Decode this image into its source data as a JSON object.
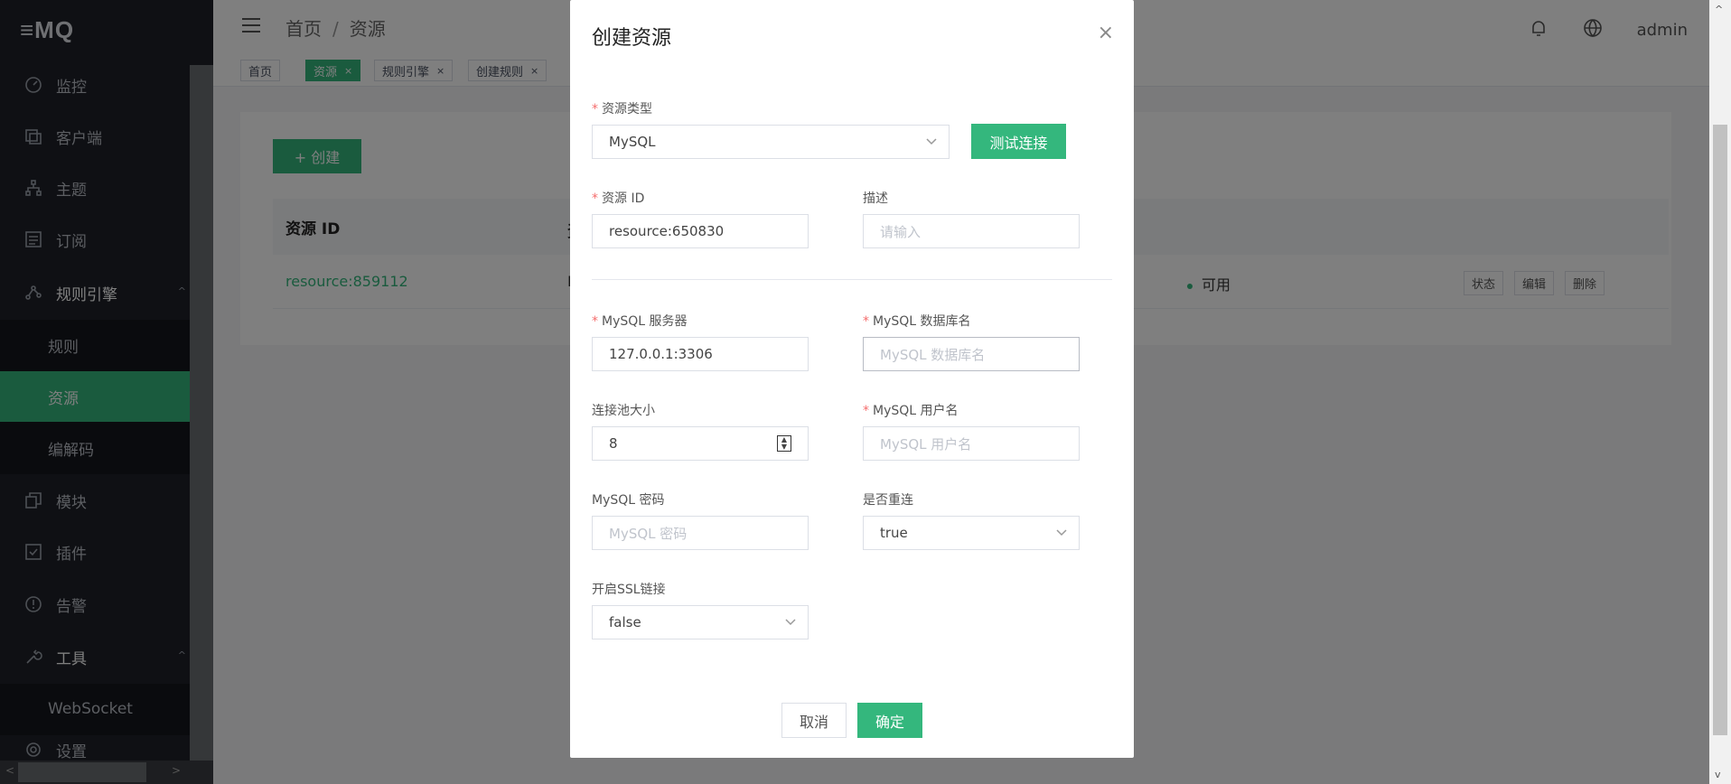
{
  "app": {
    "logo": "≡MQ"
  },
  "sidebar": {
    "items": [
      {
        "label": "监控"
      },
      {
        "label": "客户端"
      },
      {
        "label": "主题"
      },
      {
        "label": "订阅"
      },
      {
        "label": "规则引擎"
      },
      {
        "label": "模块"
      },
      {
        "label": "插件"
      },
      {
        "label": "告警"
      },
      {
        "label": "工具"
      },
      {
        "label": "设置"
      }
    ],
    "rule_sub": [
      {
        "label": "规则"
      },
      {
        "label": "资源"
      },
      {
        "label": "编解码"
      }
    ],
    "tools_sub": [
      {
        "label": "WebSocket"
      }
    ]
  },
  "header": {
    "breadcrumb": [
      "首页",
      "资源"
    ],
    "separator": "/",
    "user": "admin"
  },
  "tags": [
    {
      "label": "首页"
    },
    {
      "label": "资源",
      "close": "×"
    },
    {
      "label": "规则引擎",
      "close": "×"
    },
    {
      "label": "创建规则",
      "close": "×"
    }
  ],
  "main": {
    "create_label": "+  创建",
    "table": {
      "headers": [
        "资源 ID",
        "资"
      ],
      "rows": [
        {
          "id": "resource:859112",
          "partial": "M",
          "status": "可用",
          "actions": [
            "状态",
            "编辑",
            "删除"
          ]
        }
      ]
    }
  },
  "dialog": {
    "title": "创建资源",
    "close": "×",
    "type_label": "资源类型",
    "type_value": "MySQL",
    "test_label": "测试连接",
    "id_label": "资源 ID",
    "id_value": "resource:650830",
    "desc_label": "描述",
    "desc_placeholder": "请输入",
    "server_label": "MySQL 服务器",
    "server_value": "127.0.0.1:3306",
    "db_label": "MySQL 数据库名",
    "db_placeholder": "MySQL 数据库名",
    "pool_label": "连接池大小",
    "pool_value": "8",
    "user_label": "MySQL 用户名",
    "user_placeholder": "MySQL 用户名",
    "pwd_label": "MySQL 密码",
    "pwd_placeholder": "MySQL 密码",
    "reconnect_label": "是否重连",
    "reconnect_value": "true",
    "ssl_label": "开启SSL链接",
    "ssl_value": "false",
    "required_mark": "*",
    "cancel_label": "取消",
    "ok_label": "确定"
  },
  "colors": {
    "accent": "#34b77d",
    "sidebar": "#1e2128",
    "required": "#f56c6c"
  }
}
